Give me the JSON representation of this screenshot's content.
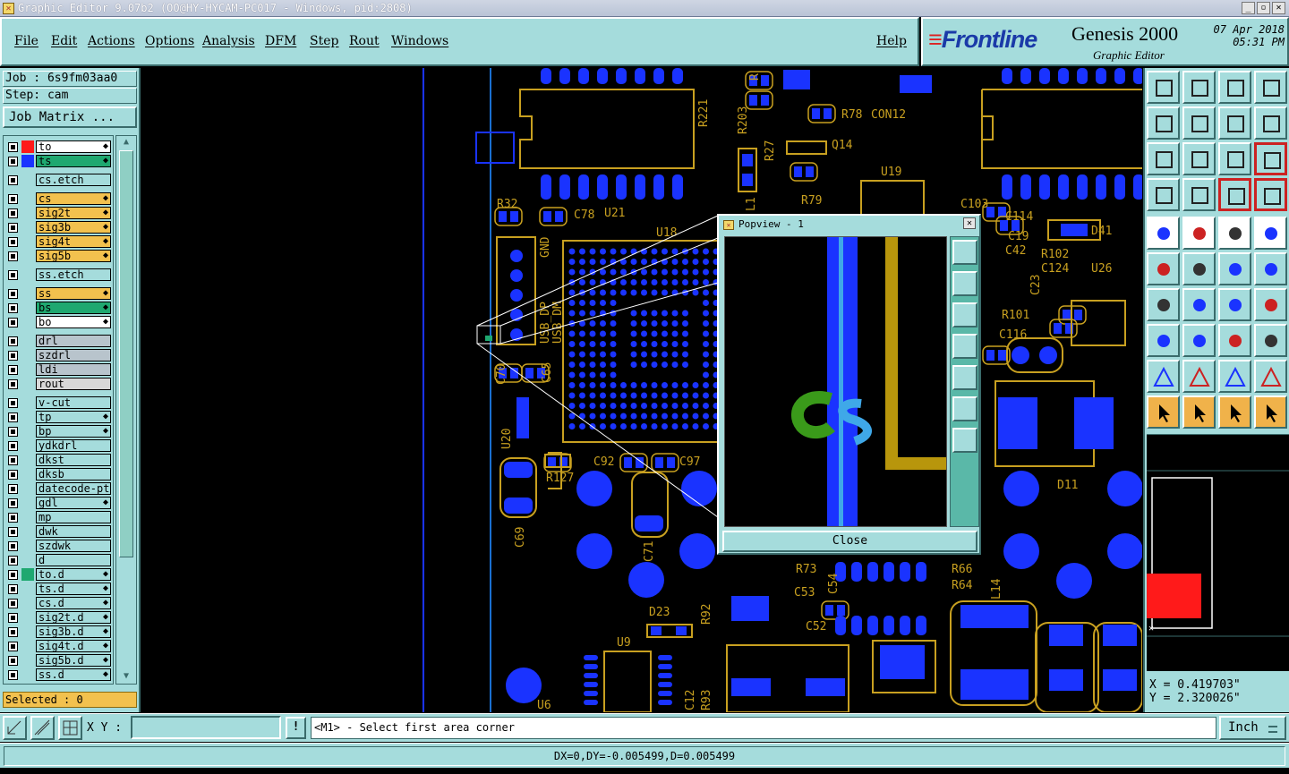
{
  "window": {
    "title": "Graphic Editor 9.07b2 (OO@HY-HYCAM-PC017 - Windows, pid:2808)"
  },
  "menu": [
    {
      "label": "File",
      "name": "menu-file"
    },
    {
      "label": "Edit",
      "name": "menu-edit"
    },
    {
      "label": "Actions",
      "name": "menu-actions"
    },
    {
      "label": "Options",
      "name": "menu-options"
    },
    {
      "label": "Analysis",
      "name": "menu-analysis"
    },
    {
      "label": "DFM",
      "name": "menu-dfm"
    },
    {
      "label": "Step",
      "name": "menu-step"
    },
    {
      "label": "Rout",
      "name": "menu-rout"
    },
    {
      "label": "Windows",
      "name": "menu-windows"
    },
    {
      "label": "Help",
      "name": "menu-help"
    }
  ],
  "brand": {
    "logo": "Frontline",
    "product": "Genesis 2000",
    "subtitle": "Graphic Editor",
    "date": "07 Apr 2018",
    "time": "05:31 PM"
  },
  "job": {
    "job_label": "Job : 6s9fm03aa0",
    "step_label": "Step: cam",
    "matrix_button": "Job Matrix ..."
  },
  "layers": [
    {
      "name": "to",
      "bg": "#ffffff",
      "swatch": "#ff1a1a",
      "mark": "◆",
      "gap": false
    },
    {
      "name": "ts",
      "bg": "#1fa870",
      "swatch": "#1a33ff",
      "mark": "◆",
      "gap": false
    },
    {
      "name": "cs.etch",
      "bg": "#a5dcdc",
      "swatch": "",
      "mark": "",
      "gap": true
    },
    {
      "name": "cs",
      "bg": "#f2c14e",
      "swatch": "",
      "mark": "◆",
      "gap": true
    },
    {
      "name": "sig2t",
      "bg": "#f2c14e",
      "swatch": "",
      "mark": "◆",
      "gap": false
    },
    {
      "name": "sig3b",
      "bg": "#f2c14e",
      "swatch": "",
      "mark": "◆",
      "gap": false
    },
    {
      "name": "sig4t",
      "bg": "#f2c14e",
      "swatch": "",
      "mark": "◆",
      "gap": false
    },
    {
      "name": "sig5b",
      "bg": "#f2c14e",
      "swatch": "",
      "mark": "◆",
      "gap": false
    },
    {
      "name": "ss.etch",
      "bg": "#a5dcdc",
      "swatch": "",
      "mark": "",
      "gap": true
    },
    {
      "name": "ss",
      "bg": "#f2c14e",
      "swatch": "",
      "mark": "◆",
      "gap": true
    },
    {
      "name": "bs",
      "bg": "#1fa870",
      "swatch": "",
      "mark": "◆",
      "gap": false
    },
    {
      "name": "bo",
      "bg": "#ffffff",
      "swatch": "",
      "mark": "◆",
      "gap": false
    },
    {
      "name": "drl",
      "bg": "#b8c4cc",
      "swatch": "",
      "mark": "",
      "gap": true
    },
    {
      "name": "szdrl",
      "bg": "#b8c4cc",
      "swatch": "",
      "mark": "",
      "gap": false
    },
    {
      "name": "ldi",
      "bg": "#b8c4cc",
      "swatch": "",
      "mark": "",
      "gap": false
    },
    {
      "name": "rout",
      "bg": "#d8d8d8",
      "swatch": "",
      "mark": "",
      "gap": false
    },
    {
      "name": "v-cut",
      "bg": "#a5dcdc",
      "swatch": "",
      "mark": "",
      "gap": true
    },
    {
      "name": "tp",
      "bg": "#a5dcdc",
      "swatch": "",
      "mark": "◆",
      "gap": false
    },
    {
      "name": "bp",
      "bg": "#a5dcdc",
      "swatch": "",
      "mark": "◆",
      "gap": false
    },
    {
      "name": "ydkdrl",
      "bg": "#a5dcdc",
      "swatch": "",
      "mark": "",
      "gap": false
    },
    {
      "name": "dkst",
      "bg": "#a5dcdc",
      "swatch": "",
      "mark": "",
      "gap": false
    },
    {
      "name": "dksb",
      "bg": "#a5dcdc",
      "swatch": "",
      "mark": "",
      "gap": false
    },
    {
      "name": "datecode-ptc",
      "bg": "#a5dcdc",
      "swatch": "",
      "mark": "",
      "gap": false
    },
    {
      "name": "gdl",
      "bg": "#a5dcdc",
      "swatch": "",
      "mark": "◆",
      "gap": false
    },
    {
      "name": "mp",
      "bg": "#a5dcdc",
      "swatch": "",
      "mark": "",
      "gap": false
    },
    {
      "name": "dwk",
      "bg": "#a5dcdc",
      "swatch": "",
      "mark": "",
      "gap": false
    },
    {
      "name": "szdwk",
      "bg": "#a5dcdc",
      "swatch": "",
      "mark": "",
      "gap": false
    },
    {
      "name": "d",
      "bg": "#a5dcdc",
      "swatch": "",
      "mark": "",
      "gap": false
    },
    {
      "name": "to.d",
      "bg": "#a5dcdc",
      "swatch": "#1fa870",
      "mark": "◆",
      "gap": false
    },
    {
      "name": "ts.d",
      "bg": "#a5dcdc",
      "swatch": "",
      "mark": "◆",
      "gap": false
    },
    {
      "name": "cs.d",
      "bg": "#a5dcdc",
      "swatch": "",
      "mark": "◆",
      "gap": false
    },
    {
      "name": "sig2t.d",
      "bg": "#a5dcdc",
      "swatch": "",
      "mark": "◆",
      "gap": false
    },
    {
      "name": "sig3b.d",
      "bg": "#a5dcdc",
      "swatch": "",
      "mark": "◆",
      "gap": false
    },
    {
      "name": "sig4t.d",
      "bg": "#a5dcdc",
      "swatch": "",
      "mark": "◆",
      "gap": false
    },
    {
      "name": "sig5b.d",
      "bg": "#a5dcdc",
      "swatch": "",
      "mark": "◆",
      "gap": false
    },
    {
      "name": "ss.d",
      "bg": "#a5dcdc",
      "swatch": "",
      "mark": "◆",
      "gap": false
    }
  ],
  "selected_label": "Selected : 0",
  "popview": {
    "title": "Popview - 1",
    "close_label": "Close"
  },
  "pcb_labels": [
    "R221",
    "R203",
    "R78",
    "CON12",
    "Q14",
    "R27",
    "R79",
    "U19",
    "C103",
    "C114",
    "C19",
    "D41",
    "C42",
    "R102",
    "C124",
    "U26",
    "C23",
    "R101",
    "C116",
    "D11",
    "R32",
    "C78",
    "U21",
    "U18",
    "USB_DP",
    "USB_DM",
    "GND",
    "C70",
    "C65",
    "U20",
    "C69",
    "C92",
    "C97",
    "R127",
    "C71",
    "R73",
    "R66",
    "R64",
    "C53",
    "C54",
    "L14",
    "C52",
    "D23",
    "R92",
    "U9",
    "C12",
    "R93",
    "U6",
    "L1",
    "R"
  ],
  "coordinates": {
    "x": "X = 0.419703\"",
    "y": "Y = 2.320026\""
  },
  "command": {
    "xy_label": "X Y :",
    "xy_value": "",
    "exclaim": "!",
    "prompt": "<M1> - Select first area corner",
    "unit": "Inch"
  },
  "status": "DX=0,DY=-0.005499,D=0.005499",
  "colors": {
    "panel": "#a5dcdc",
    "copper": "#b8960c",
    "pad": "#1a33ff",
    "silk": "#c8a020",
    "ts_layer": "#1fa870"
  }
}
